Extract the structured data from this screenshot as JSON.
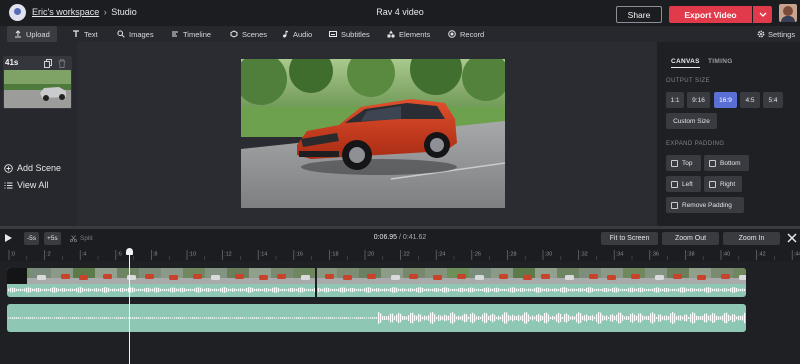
{
  "header": {
    "workspace": "Eric's workspace",
    "separator": "›",
    "section": "Studio",
    "project_title": "Rav 4 video",
    "share_label": "Share",
    "export_label": "Export Video"
  },
  "toolbar": {
    "items": [
      {
        "label": "Upload",
        "icon": "upload-icon"
      },
      {
        "label": "Text",
        "icon": "text-icon"
      },
      {
        "label": "Images",
        "icon": "search-icon"
      },
      {
        "label": "Timeline",
        "icon": "timeline-icon"
      },
      {
        "label": "Scenes",
        "icon": "scenes-icon"
      },
      {
        "label": "Audio",
        "icon": "music-note-icon"
      },
      {
        "label": "Subtitles",
        "icon": "subtitles-icon"
      },
      {
        "label": "Elements",
        "icon": "shapes-icon"
      },
      {
        "label": "Record",
        "icon": "record-icon"
      }
    ],
    "active": "Upload",
    "settings_label": "Settings"
  },
  "scenes": {
    "items": [
      {
        "duration": "41s"
      }
    ],
    "add_label": "Add Scene",
    "view_all_label": "View All"
  },
  "properties": {
    "tabs": [
      "CANVAS",
      "TIMING"
    ],
    "active_tab": "CANVAS",
    "output_size_label": "OUTPUT SIZE",
    "ratios": [
      "1:1",
      "9:16",
      "16:9",
      "4:5",
      "5:4"
    ],
    "selected_ratio": "16:9",
    "custom_size_label": "Custom Size",
    "expand_padding_label": "EXPAND PADDING",
    "padding_options": [
      "Top",
      "Bottom",
      "Left",
      "Right",
      "Remove Padding"
    ]
  },
  "timeline": {
    "skip_back_label": "-5s",
    "skip_forward_label": "+5s",
    "split_label": "Split",
    "current_time": "0:06.95",
    "time_separator": " / ",
    "total_time": "0:41.62",
    "fit_label": "Fit to Screen",
    "zoom_out_label": "Zoom Out",
    "zoom_in_label": "Zoom In",
    "ruler_ticks": [
      ":0",
      ":2",
      ":4",
      ":6",
      ":8",
      ":10",
      ":12",
      ":14",
      ":16",
      ":18",
      ":20",
      ":22",
      ":24",
      ":26",
      ":28",
      ":30",
      ":32",
      ":34",
      ":36",
      ":38",
      ":40",
      ":42",
      ":44"
    ]
  },
  "colors": {
    "accent_red": "#e13a4b",
    "selected_blue": "#5a6fd6",
    "waveform_teal": "#8fc7b5",
    "background": "#1f2024"
  }
}
